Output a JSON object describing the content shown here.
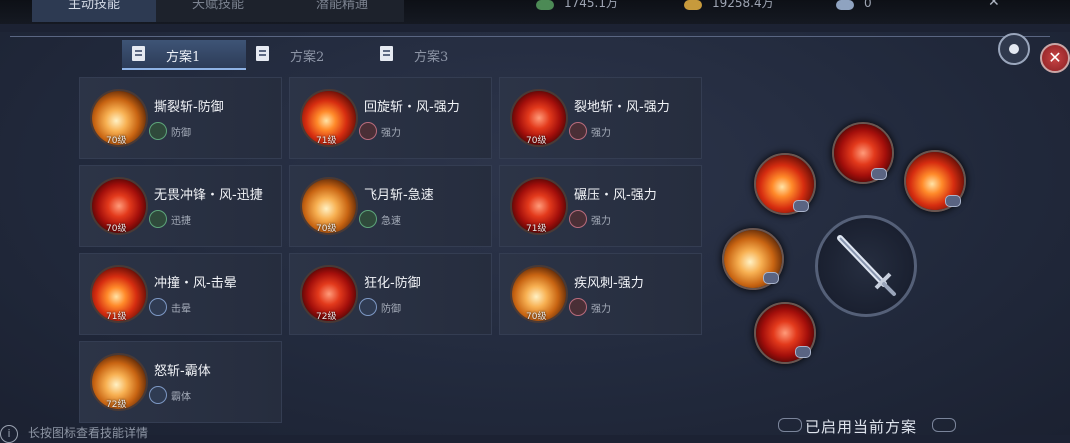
{
  "top_tabs": [
    {
      "label": "主动技能",
      "active": true
    },
    {
      "label": "天赋技能",
      "active": false
    },
    {
      "label": "潜能精通",
      "active": false
    }
  ],
  "resources": [
    {
      "icon": "jade-currency-icon",
      "value": "1745.1万"
    },
    {
      "icon": "gold-coin-icon",
      "value": "19258.4万"
    },
    {
      "icon": "silver-ingot-icon",
      "value": "0"
    }
  ],
  "plan_tabs": [
    {
      "label": "方案1",
      "active": true
    },
    {
      "label": "方案2",
      "active": false
    },
    {
      "label": "方案3",
      "active": false
    }
  ],
  "skills": [
    {
      "name": "撕裂斩-防御",
      "level": "70级",
      "attr": "防御",
      "attr_type": "green"
    },
    {
      "name": "回旋斩・风-强力",
      "level": "71级",
      "attr": "强力",
      "attr_type": "red"
    },
    {
      "name": "裂地斩・风-强力",
      "level": "70级",
      "attr": "强力",
      "attr_type": "red"
    },
    {
      "name": "无畏冲锋・风-迅捷",
      "level": "70级",
      "attr": "迅捷",
      "attr_type": "green"
    },
    {
      "name": "飞月斩-急速",
      "level": "70级",
      "attr": "急速",
      "attr_type": "green"
    },
    {
      "name": "碾压・风-强力",
      "level": "71级",
      "attr": "强力",
      "attr_type": "red"
    },
    {
      "name": "冲撞・风-击晕",
      "level": "71级",
      "attr": "击晕",
      "attr_type": "blue"
    },
    {
      "name": "狂化-防御",
      "level": "72级",
      "attr": "防御",
      "attr_type": "blue"
    },
    {
      "name": "疾风刺-强力",
      "level": "70级",
      "attr": "强力",
      "attr_type": "red"
    },
    {
      "name": "怒斩-霸体",
      "level": "72级",
      "attr": "霸体",
      "attr_type": "blue"
    }
  ],
  "footer": {
    "status": "已启用当前方案",
    "hint": "长按图标查看技能详情"
  }
}
